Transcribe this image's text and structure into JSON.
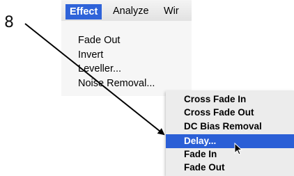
{
  "callout_number": "8",
  "menubar": {
    "items": [
      {
        "label": "Effect"
      },
      {
        "label": "Analyze"
      },
      {
        "label": "Wir"
      }
    ]
  },
  "effect_menu": {
    "items": [
      {
        "label": "Fade Out"
      },
      {
        "label": "Invert"
      },
      {
        "label": "Leveller..."
      },
      {
        "label": "Noise Removal..."
      }
    ]
  },
  "submenu": {
    "items": [
      {
        "label": "Cross Fade In"
      },
      {
        "label": "Cross Fade Out"
      },
      {
        "label": "DC Bias Removal"
      },
      {
        "label": "Delay..."
      },
      {
        "label": "Fade In"
      },
      {
        "label": "Fade Out"
      }
    ],
    "selected": "Delay..."
  },
  "colors": {
    "highlight": "#2b5fd6",
    "menubar_active": "#2f63d9"
  }
}
